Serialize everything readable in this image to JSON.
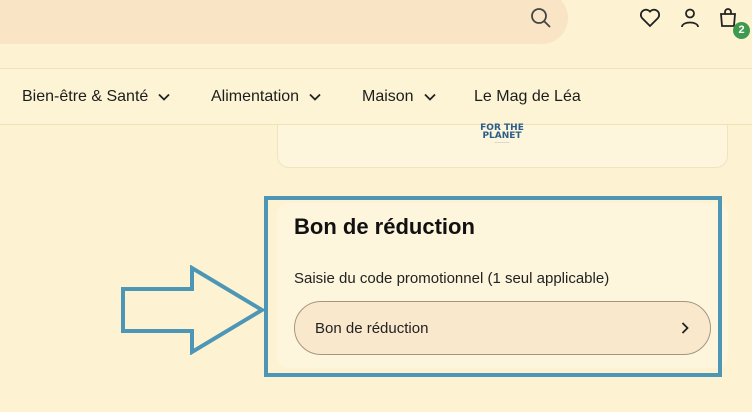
{
  "header": {
    "icons": [
      "search-icon",
      "heart-icon",
      "user-icon",
      "cart-icon"
    ],
    "cart_count": "2"
  },
  "nav": {
    "items": [
      {
        "label": "Bien-être & Santé"
      },
      {
        "label": "Alimentation"
      },
      {
        "label": "Maison"
      },
      {
        "label": "Le Mag de Léa"
      }
    ]
  },
  "logo": {
    "line1": "FOR THE",
    "line2": "PLANET"
  },
  "voucher": {
    "title": "Bon de réduction",
    "label": "Saisie du code promotionnel (1 seul applicable)",
    "field_text": "Bon de réduction"
  },
  "colors": {
    "background": "#fdf3d2",
    "search_bg": "#fae4c6",
    "badge": "#3e9a4f",
    "highlight": "#4d96b6"
  }
}
